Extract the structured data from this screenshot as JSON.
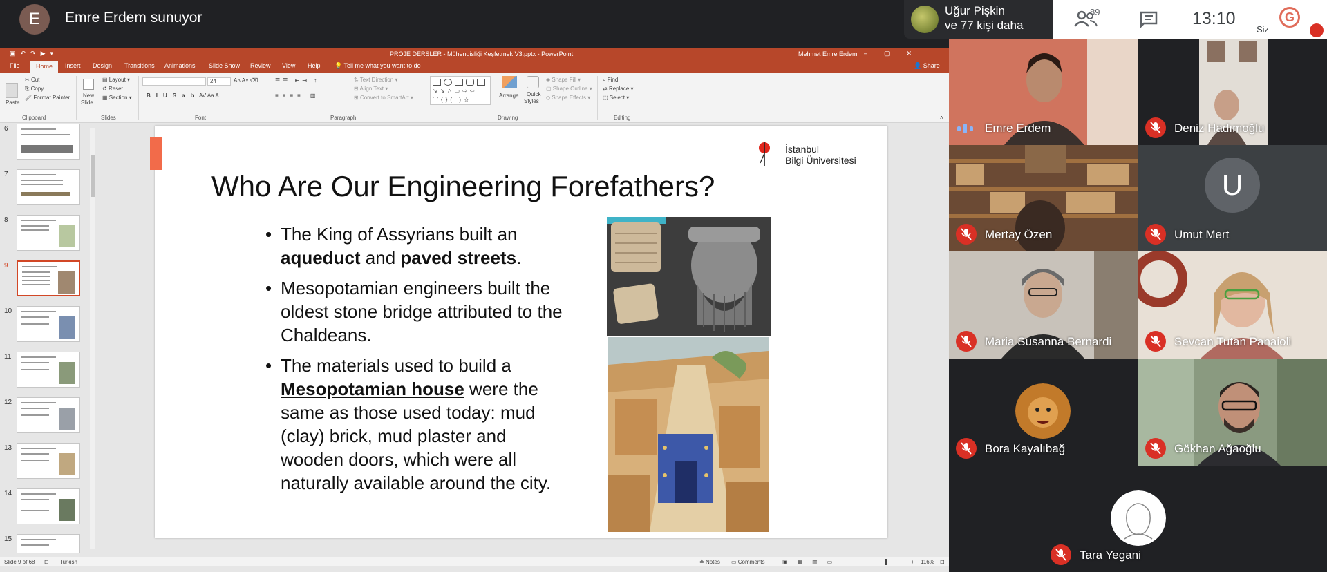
{
  "meet": {
    "presenter_initial": "E",
    "presenter_title": "Emre Erdem sunuyor",
    "pill_line1": "Uğur Pişkin",
    "pill_line2": "ve 77 kişi daha",
    "people_count": "89",
    "time": "13:10",
    "you_label": "Siz"
  },
  "ppt": {
    "document_title": "PROJE DERSLER - Mühendisliği Keşfetmek V3.pptx  -  PowerPoint",
    "user_name": "Mehmet Emre Erdem",
    "tabs": [
      "File",
      "Home",
      "Insert",
      "Design",
      "Transitions",
      "Animations",
      "Slide Show",
      "Review",
      "View",
      "Help"
    ],
    "tell_me": "Tell me what you want to do",
    "share": "Share",
    "ribbon": {
      "paste": "Paste",
      "cut": "Cut",
      "copy": "Copy",
      "format_painter": "Format Painter",
      "clipboard": "Clipboard",
      "new_slide": "New",
      "new_slide2": "Slide",
      "layout": "Layout",
      "reset": "Reset",
      "section": "Section",
      "slides": "Slides",
      "font_size": "24",
      "font": "Font",
      "text_direction": "Text Direction",
      "align_text": "Align Text",
      "convert_smartart": "Convert to SmartArt",
      "paragraph": "Paragraph",
      "arrange": "Arrange",
      "quick_styles": "Quick",
      "quick_styles2": "Styles",
      "shape_fill": "Shape Fill",
      "shape_outline": "Shape Outline",
      "shape_effects": "Shape Effects",
      "drawing": "Drawing",
      "find": "Find",
      "replace": "Replace",
      "select": "Select",
      "editing": "Editing"
    },
    "thumbnails": [
      "6",
      "7",
      "8",
      "9",
      "10",
      "11",
      "12",
      "13",
      "14",
      "15"
    ],
    "active_thumbnail": "9",
    "status": {
      "slide_of": "Slide 9 of 68",
      "language": "Turkish",
      "notes": "Notes",
      "comments": "Comments",
      "zoom": "116%"
    }
  },
  "slide": {
    "logo_line1": "İstanbul",
    "logo_line2": "Bilgi Üniversitesi",
    "title": "Who Are Our Engineering Forefathers?",
    "b1_a": "The King of Assyrians built an ",
    "b1_bold1": "aqueduct",
    "b1_mid": " and ",
    "b1_bold2": "paved streets",
    "b1_end": ".",
    "b2": "Mesopotamian engineers built the oldest stone bridge attributed to the Chaldeans.",
    "b3_a": "The materials used to build a ",
    "b3_bold": "Mesopotamian house",
    "b3_end": " were the same as those used today: mud (clay) brick, mud plaster and wooden doors, which were all naturally available around the city."
  },
  "participants": [
    {
      "name": "Emre Erdem",
      "muted": false
    },
    {
      "name": "Deniz Hadımoğlu",
      "muted": true
    },
    {
      "name": "Mertay Özen",
      "muted": true
    },
    {
      "name": "Umut Mert",
      "muted": true,
      "initial": "U"
    },
    {
      "name": "Maria Susanna Bernardi",
      "muted": true
    },
    {
      "name": "Sevcan Tutan Panaioli",
      "muted": true
    },
    {
      "name": "Bora Kayalıbağ",
      "muted": true
    },
    {
      "name": "Gökhan Ağaoğlu",
      "muted": true
    },
    {
      "name": "Tara Yegani",
      "muted": true
    }
  ],
  "colors": {
    "ppt_accent": "#b7472a",
    "slide_accent": "#f26b4a",
    "mute_red": "#d93025"
  }
}
